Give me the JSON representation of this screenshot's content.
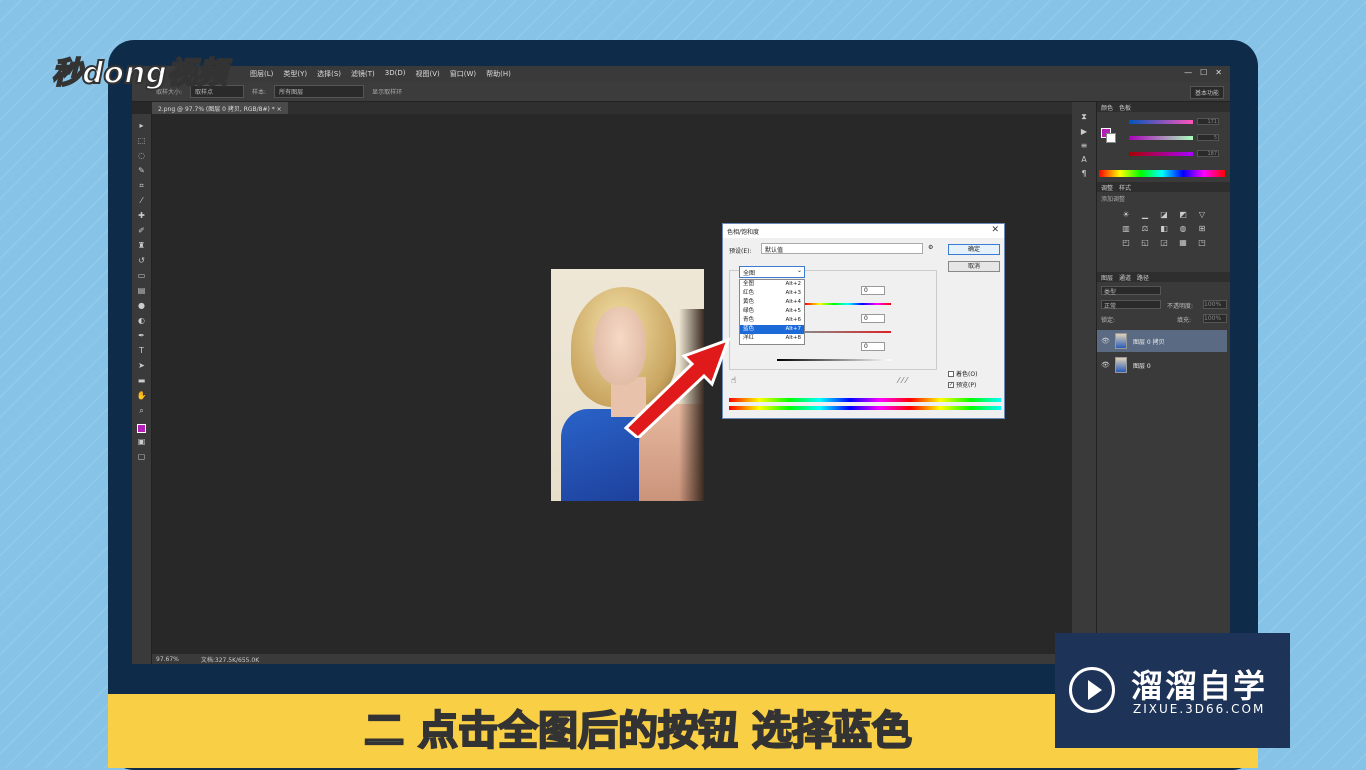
{
  "video_logo": "秒dong视频",
  "ps": {
    "menus": [
      "图层(L)",
      "类型(Y)",
      "选择(S)",
      "滤镜(T)",
      "3D(D)",
      "视图(V)",
      "窗口(W)",
      "帮助(H)"
    ],
    "window_controls": [
      "—",
      "☐",
      "✕"
    ],
    "options": {
      "size_label": "取样大小:",
      "size_value": "取样点",
      "sample_label": "样本:",
      "sample_value": "所有图层",
      "ring_label": "显示取样环"
    },
    "workspace": "基本功能",
    "doc_tab": "2.png @ 97.7% (图层 0 拷贝, RGB/8#) * ×",
    "status": {
      "zoom": "97.67%",
      "doc": "文档:327.5K/655.0K"
    },
    "color_panel": {
      "tabs": [
        "颜色",
        "色板"
      ],
      "r": "171",
      "g": "5",
      "b": "187",
      "fg": "#b41fb8"
    },
    "adjust_panel": {
      "tabs": [
        "调整",
        "样式"
      ],
      "title": "添加调整"
    },
    "layers_panel": {
      "tabs": [
        "图层",
        "通道",
        "路径"
      ],
      "kind": "类型",
      "blend": "正常",
      "opacity_label": "不透明度:",
      "opacity": "100%",
      "lock_label": "锁定:",
      "fill_label": "填充:",
      "fill": "100%",
      "layers": [
        {
          "name": "图层 0 拷贝",
          "selected": true
        },
        {
          "name": "图层 0",
          "selected": false
        }
      ]
    }
  },
  "dialog": {
    "title": "色相/饱和度",
    "preset_label": "预设(E):",
    "preset_value": "默认值",
    "ok": "确定",
    "cancel": "取消",
    "channel_value": "全图",
    "channel_items": [
      {
        "name": "全图",
        "key": "Alt+2"
      },
      {
        "name": "红色",
        "key": "Alt+3"
      },
      {
        "name": "黄色",
        "key": "Alt+4"
      },
      {
        "name": "绿色",
        "key": "Alt+5"
      },
      {
        "name": "青色",
        "key": "Alt+6"
      },
      {
        "name": "蓝色",
        "key": "Alt+7"
      },
      {
        "name": "洋红",
        "key": "Alt+8"
      }
    ],
    "selected_index": 5,
    "hue": "0",
    "saturation": "0",
    "lightness": "0",
    "colorize": "着色(O)",
    "preview": "预览(P)"
  },
  "subtitle": "二 点击全图后的按钮 选择蓝色",
  "brand": {
    "name": "溜溜自学",
    "url": "ZIXUE.3D66.COM"
  }
}
